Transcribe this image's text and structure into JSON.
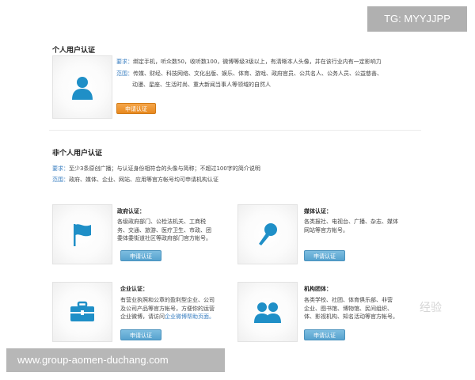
{
  "watermarks": {
    "top": "TG: MYYJJPP",
    "bottom": "www.group-aomen-duchang.com"
  },
  "personal": {
    "title": "个人用户认证",
    "req_label": "要求：",
    "req_text": "绑定手机，听众数50，收听数100，微博等级3级以上，有清晰本人头像，并在该行业内有一定影响力",
    "scope_label": "范围：",
    "scope_line1": "传媒、财经、科技网络、文化出版、娱乐、体育、游戏、政府官员、公共名人、公务人员、公益慈善、",
    "scope_line2": "动漫、星座、生活时尚、重大新闻当事人等领域的自然人",
    "button": "申请认证",
    "icon": "person-icon"
  },
  "non_personal": {
    "title": "非个人用户认证",
    "req_label": "要求：",
    "req_text": "至少3条原创广播；与认证身份相符合的头像与简称；不超过100字的简介说明",
    "scope_label": "范围：",
    "scope_text": "政府、媒体、企业、网站、应用等官方帐号均可申请机构认证"
  },
  "cards": [
    {
      "title": "政府认证：",
      "desc1": "各级政府部门、公检法机关、工商税",
      "desc2": "务、交通、旅游、医疗卫生、市政、团",
      "desc3": "委体委街道社区等政府部门官方帐号。",
      "button": "申请认证",
      "icon": "flag-icon"
    },
    {
      "title": "媒体认证：",
      "desc1": "各类报社、电视台、广播、杂志、媒体",
      "desc2": "网站等官方帐号。",
      "desc3": "",
      "button": "申请认证",
      "icon": "microphone-icon"
    },
    {
      "title": "企业认证：",
      "desc1": "有营业执照和公章的盈利型企业、公司",
      "desc2": "及公司产品等官方帐号，方便你的运营",
      "desc3a": "企业微博，请访问",
      "desc3b": "企业微博帮助页面。",
      "button": "申请认证",
      "icon": "briefcase-icon"
    },
    {
      "title": "机构团体：",
      "desc1": "各类学校、社团、体育俱乐部、非营",
      "desc2": "企业、图书馆、博物馆、民间组织、",
      "desc3": "体、影视机构、知名活动等官方帐号。",
      "button": "申请认证",
      "icon": "group-icon"
    }
  ],
  "faded_overlay": "经验"
}
